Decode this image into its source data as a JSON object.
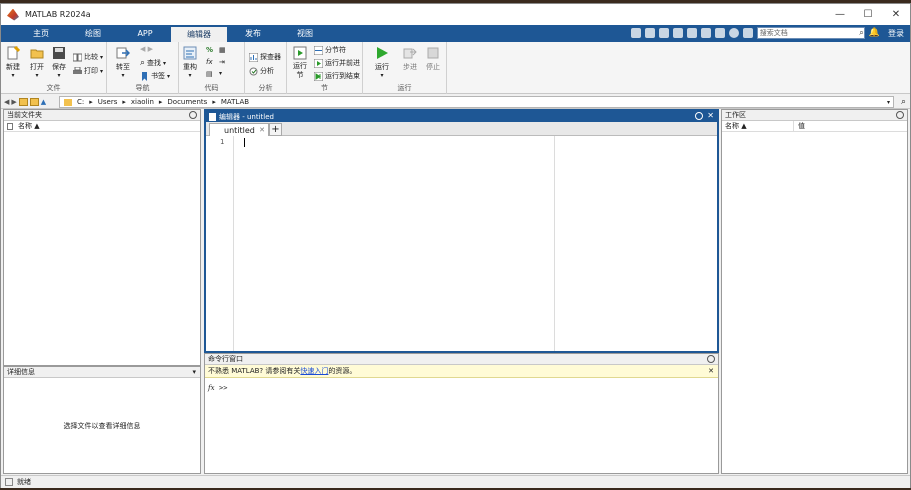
{
  "window": {
    "title": "MATLAB R2024a",
    "controls": [
      "—",
      "☐",
      "✕"
    ]
  },
  "tabs": [
    {
      "label": "主页",
      "active": false
    },
    {
      "label": "绘图",
      "active": false
    },
    {
      "label": "APP",
      "active": false
    },
    {
      "label": "编辑器",
      "active": true
    },
    {
      "label": "发布",
      "active": false
    },
    {
      "label": "视图",
      "active": false
    }
  ],
  "search": {
    "placeholder": "搜索文档"
  },
  "login_label": "登录",
  "toolstrip": {
    "file": {
      "label": "文件",
      "new": "新建",
      "open": "打开",
      "save": "保存",
      "compare": "比较",
      "print": "打印"
    },
    "nav": {
      "label": "导航",
      "goto": "转至",
      "find": "查找",
      "bookmark": "书签"
    },
    "code": {
      "label": "代码",
      "refactor": "重构"
    },
    "analyze": {
      "label": "分析",
      "profiler": "探查器",
      "analyze": "分析"
    },
    "section": {
      "label": "节",
      "run_section": "运行节",
      "section_break": "分节符",
      "run_advance": "运行并前进",
      "run_to_end": "运行到结束"
    },
    "run": {
      "label": "运行",
      "run": "运行",
      "step": "步进",
      "stop": "停止"
    }
  },
  "address": {
    "parts": [
      "C:",
      "Users",
      "xiaolin",
      "Documents",
      "MATLAB"
    ]
  },
  "current_folder": {
    "title": "当前文件夹",
    "col_name": "名称 ▲"
  },
  "details": {
    "title": "详细信息",
    "empty_msg": "选择文件以查看详细信息"
  },
  "editor": {
    "title": "编辑器 - untitled",
    "tab_label": "untitled",
    "line_number": "1"
  },
  "command_window": {
    "title": "命令行窗口",
    "notice_pre": "不熟悉 MATLAB? 请参阅有关",
    "notice_link": "快速入门",
    "notice_post": "的资源。",
    "fx": "fx",
    "prompt": ">>"
  },
  "workspace": {
    "title": "工作区",
    "col_name": "名称 ▲",
    "col_value": "值"
  },
  "status": {
    "text": "就绪"
  },
  "colors": {
    "tab_blue": "#1e5795",
    "notice_bg": "#fffbd6"
  }
}
